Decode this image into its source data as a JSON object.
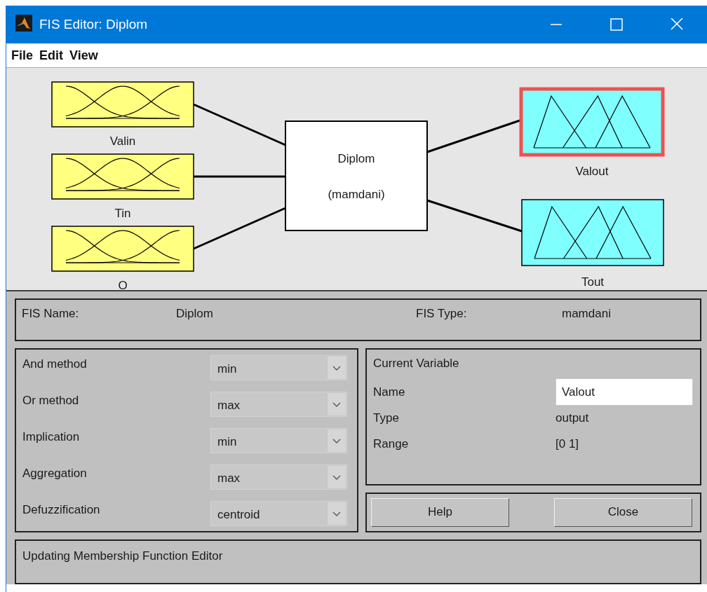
{
  "window": {
    "title": "FIS Editor: Diplom"
  },
  "menu": [
    "File",
    "Edit",
    "View"
  ],
  "inputs": [
    {
      "name": "Valin",
      "selected": false
    },
    {
      "name": "Tin",
      "selected": false
    },
    {
      "name": "O",
      "selected": false
    }
  ],
  "system": {
    "name": "Diplom",
    "type": "(mamdani)"
  },
  "outputs": [
    {
      "name": "Valout",
      "selected": true
    },
    {
      "name": "Tout",
      "selected": false
    }
  ],
  "fis_info": [
    {
      "label": "FIS Name:",
      "value": "Diplom"
    },
    {
      "label": "FIS Type:",
      "value": "mamdani"
    }
  ],
  "methods": [
    {
      "label": "And method",
      "value": "min"
    },
    {
      "label": "Or method",
      "value": "max"
    },
    {
      "label": "Implication",
      "value": "min"
    },
    {
      "label": "Aggregation",
      "value": "max"
    },
    {
      "label": "Defuzzification",
      "value": "centroid"
    }
  ],
  "current_variable": {
    "title": "Current Variable",
    "fields": [
      {
        "label": "Name",
        "value": "Valout",
        "kind": "input"
      },
      {
        "label": "Type",
        "value": "output",
        "kind": "text"
      },
      {
        "label": "Range",
        "value": "[0 1]",
        "kind": "text"
      }
    ]
  },
  "buttons": [
    "Help",
    "Close"
  ],
  "status": "Updating Membership Function Editor"
}
